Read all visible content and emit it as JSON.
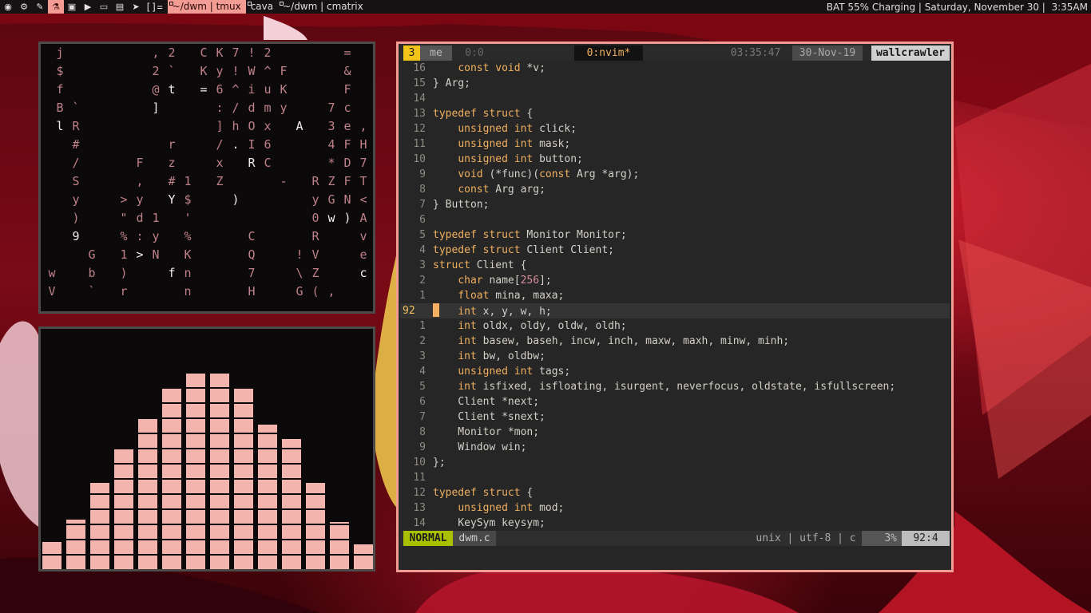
{
  "colors": {
    "accent": "#f29c94",
    "bar_bg": "#141213",
    "mode_green": "#a8c000",
    "keyword": "#f0b060",
    "number": "#d88ea0"
  },
  "topbar": {
    "icons": [
      "firefox-icon",
      "steam-icon",
      "brush-icon",
      "flask-icon",
      "image-icon",
      "video-icon",
      "monitor-icon",
      "folder-icon",
      "telegram-icon"
    ],
    "layout": "[]=",
    "tags": [
      {
        "label": "~/dwm | tmux",
        "active": true
      },
      {
        "label": "cava",
        "active": false
      },
      {
        "label": "~/dwm | cmatrix",
        "active": false
      }
    ],
    "status": "BAT 55% Charging | Saturday, November 30 |  3:35AM"
  },
  "cmatrix": {
    "cells": [
      [
        "j",
        0,
        0
      ],
      [
        "$",
        0,
        1
      ],
      [
        "f",
        0,
        2
      ],
      [
        "B",
        0,
        3
      ],
      [
        "l",
        0,
        4
      ],
      [
        "`",
        1,
        3
      ],
      [
        "R",
        1,
        4
      ],
      [
        "#",
        1,
        5
      ],
      [
        "/",
        1,
        6
      ],
      [
        "S",
        1,
        7
      ],
      [
        "y",
        1,
        8
      ],
      [
        ")",
        1,
        9
      ],
      [
        "9",
        1,
        10
      ],
      [
        "G",
        2,
        11
      ],
      [
        "b",
        2,
        12
      ],
      [
        "`",
        2,
        13
      ],
      [
        "w",
        -1,
        12
      ],
      [
        "V",
        -1,
        13
      ],
      [
        ">",
        4,
        8
      ],
      [
        "\"",
        4,
        9
      ],
      [
        "%",
        4,
        10
      ],
      [
        "1",
        4,
        11
      ],
      [
        ")",
        4,
        12
      ],
      [
        "r",
        4,
        13
      ],
      [
        "F",
        5,
        6
      ],
      [
        ",",
        5,
        7
      ],
      [
        "y",
        5,
        8
      ],
      [
        "d",
        5,
        9
      ],
      [
        ":",
        5,
        10
      ],
      [
        ">",
        5,
        11
      ],
      [
        ",",
        6,
        0
      ],
      [
        "2",
        6,
        1
      ],
      [
        "@",
        6,
        2
      ],
      [
        "]",
        6,
        3
      ],
      [
        "r",
        7,
        5
      ],
      [
        "z",
        7,
        6
      ],
      [
        "#",
        7,
        7
      ],
      [
        "Y",
        7,
        8
      ],
      [
        "1",
        6,
        9
      ],
      [
        "y",
        6,
        10
      ],
      [
        "N",
        6,
        11
      ],
      [
        "f",
        7,
        12
      ],
      [
        "2",
        7,
        0
      ],
      [
        "`",
        7,
        1
      ],
      [
        "t",
        7,
        2
      ],
      [
        "1",
        8,
        7
      ],
      [
        "$",
        8,
        8
      ],
      [
        "'",
        8,
        9
      ],
      [
        "%",
        8,
        10
      ],
      [
        "K",
        8,
        11
      ],
      [
        "n",
        8,
        12
      ],
      [
        "n",
        8,
        13
      ],
      [
        "C",
        9,
        0
      ],
      [
        "K",
        9,
        1
      ],
      [
        "=",
        9,
        2
      ],
      [
        "K",
        10,
        0
      ],
      [
        "y",
        10,
        1
      ],
      [
        "6",
        10,
        2
      ],
      [
        ":",
        10,
        3
      ],
      [
        "]",
        10,
        4
      ],
      [
        "/",
        10,
        5
      ],
      [
        "x",
        10,
        6
      ],
      [
        "Z",
        10,
        7
      ],
      [
        ")",
        11,
        8
      ],
      [
        "7",
        11,
        0
      ],
      [
        "!",
        11,
        1
      ],
      [
        "^",
        11,
        2
      ],
      [
        "/",
        11,
        3
      ],
      [
        "h",
        11,
        4
      ],
      [
        ".",
        11,
        5
      ],
      [
        "R",
        12,
        6
      ],
      [
        "!",
        12,
        0
      ],
      [
        "W",
        12,
        1
      ],
      [
        "i",
        12,
        2
      ],
      [
        "d",
        12,
        3
      ],
      [
        "O",
        12,
        4
      ],
      [
        "I",
        12,
        5
      ],
      [
        "C",
        12,
        10
      ],
      [
        "Q",
        12,
        11
      ],
      [
        "7",
        12,
        12
      ],
      [
        "H",
        12,
        13
      ],
      [
        "2",
        13,
        0
      ],
      [
        "^",
        13,
        1
      ],
      [
        "u",
        13,
        2
      ],
      [
        "m",
        13,
        3
      ],
      [
        "x",
        13,
        4
      ],
      [
        "6",
        13,
        5
      ],
      [
        "C",
        13,
        6
      ],
      [
        "-",
        14,
        7
      ],
      [
        "F",
        14,
        1
      ],
      [
        "K",
        14,
        2
      ],
      [
        "y",
        14,
        3
      ],
      [
        "A",
        15,
        4
      ],
      [
        "R",
        16,
        7
      ],
      [
        "y",
        16,
        8
      ],
      [
        "0",
        16,
        9
      ],
      [
        "R",
        16,
        10
      ],
      [
        "V",
        16,
        11
      ],
      [
        "Z",
        16,
        12
      ],
      [
        "G",
        15,
        13
      ],
      [
        "!",
        15,
        11
      ],
      [
        "\\",
        15,
        12
      ],
      [
        "(",
        16,
        13
      ],
      [
        "7",
        17,
        3
      ],
      [
        "3",
        17,
        4
      ],
      [
        "4",
        17,
        5
      ],
      [
        "*",
        17,
        6
      ],
      [
        "Z",
        17,
        7
      ],
      [
        "G",
        17,
        8
      ],
      [
        "w",
        17,
        9
      ],
      [
        ",",
        17,
        13
      ],
      [
        "=",
        18,
        0
      ],
      [
        "&",
        18,
        1
      ],
      [
        "F",
        18,
        2
      ],
      [
        "c",
        18,
        3
      ],
      [
        "e",
        18,
        4
      ],
      [
        "F",
        18,
        5
      ],
      [
        "D",
        18,
        6
      ],
      [
        "F",
        18,
        7
      ],
      [
        "N",
        18,
        8
      ],
      [
        ")",
        18,
        9
      ],
      [
        ",",
        19,
        4
      ],
      [
        "H",
        19,
        5
      ],
      [
        "7",
        19,
        6
      ],
      [
        "T",
        19,
        7
      ],
      [
        "<",
        19,
        8
      ],
      [
        "A",
        19,
        9
      ],
      [
        "v",
        19,
        10
      ],
      [
        "e",
        19,
        11
      ],
      [
        "c",
        19,
        12
      ],
      [
        "l",
        20,
        9
      ],
      [
        "'",
        20,
        10
      ],
      [
        ";",
        20,
        11
      ],
      [
        "9",
        20,
        12
      ],
      [
        "s",
        20,
        13
      ]
    ],
    "bright": [
      "l:0,4",
      "t:7,2",
      "=:9,2",
      "]:6,3",
      "A:15,4",
      ".:11,5",
      "R:12,6",
      "Y:7,8",
      "):11,8",
      "9:1,10",
      ">:5,11",
      "f:7,12",
      "w:17,9",
      "):18,9",
      "c:19,12"
    ]
  },
  "cava": {
    "levels": [
      0.13,
      0.24,
      0.42,
      0.58,
      0.73,
      0.88,
      0.95,
      0.95,
      0.88,
      0.7,
      0.63,
      0.42,
      0.23,
      0.12
    ]
  },
  "tmux": {
    "window_index": "3",
    "session": "me",
    "inactive_window": "0:0",
    "active_window": "0:nvim*",
    "time": "03:35:47",
    "date": "30-Nov-19",
    "host": "wallcrawler"
  },
  "nvim": {
    "lines": [
      {
        "n": "16",
        "t": [
          [
            "    ",
            ""
          ],
          [
            "const",
            "kw"
          ],
          [
            " ",
            ""
          ],
          [
            "void",
            "kw"
          ],
          [
            " *v;",
            ""
          ]
        ]
      },
      {
        "n": "15",
        "t": [
          [
            "} Arg;",
            ""
          ]
        ]
      },
      {
        "n": "14",
        "t": []
      },
      {
        "n": "13",
        "t": [
          [
            "typedef",
            "kw"
          ],
          [
            " ",
            ""
          ],
          [
            "struct",
            "kw"
          ],
          [
            " {",
            ""
          ]
        ]
      },
      {
        "n": "12",
        "t": [
          [
            "    ",
            ""
          ],
          [
            "unsigned",
            "kw"
          ],
          [
            " ",
            ""
          ],
          [
            "int",
            "kw"
          ],
          [
            " click;",
            ""
          ]
        ]
      },
      {
        "n": "11",
        "t": [
          [
            "    ",
            ""
          ],
          [
            "unsigned",
            "kw"
          ],
          [
            " ",
            ""
          ],
          [
            "int",
            "kw"
          ],
          [
            " mask;",
            ""
          ]
        ]
      },
      {
        "n": "10",
        "t": [
          [
            "    ",
            ""
          ],
          [
            "unsigned",
            "kw"
          ],
          [
            " ",
            ""
          ],
          [
            "int",
            "kw"
          ],
          [
            " button;",
            ""
          ]
        ]
      },
      {
        "n": "9",
        "t": [
          [
            "    ",
            ""
          ],
          [
            "void",
            "kw"
          ],
          [
            " (*func)(",
            ""
          ],
          [
            "const",
            "kw"
          ],
          [
            " Arg *arg);",
            ""
          ]
        ]
      },
      {
        "n": "8",
        "t": [
          [
            "    ",
            ""
          ],
          [
            "const",
            "kw"
          ],
          [
            " Arg arg;",
            ""
          ]
        ]
      },
      {
        "n": "7",
        "t": [
          [
            "} Button;",
            ""
          ]
        ]
      },
      {
        "n": "6",
        "t": []
      },
      {
        "n": "5",
        "t": [
          [
            "typedef",
            "kw"
          ],
          [
            " ",
            ""
          ],
          [
            "struct",
            "kw"
          ],
          [
            " Monitor Monitor;",
            ""
          ]
        ]
      },
      {
        "n": "4",
        "t": [
          [
            "typedef",
            "kw"
          ],
          [
            " ",
            ""
          ],
          [
            "struct",
            "kw"
          ],
          [
            " Client Client;",
            ""
          ]
        ]
      },
      {
        "n": "3",
        "t": [
          [
            "struct",
            "kw"
          ],
          [
            " Client {",
            ""
          ]
        ]
      },
      {
        "n": "2",
        "t": [
          [
            "    ",
            ""
          ],
          [
            "char",
            "kw"
          ],
          [
            " name[",
            ""
          ],
          [
            "256",
            "num"
          ],
          [
            "];",
            ""
          ]
        ]
      },
      {
        "n": "1",
        "t": [
          [
            "    ",
            ""
          ],
          [
            "float",
            "kw"
          ],
          [
            " mina, maxa;",
            ""
          ]
        ]
      },
      {
        "n": "92",
        "cur": true,
        "t": [
          [
            "    ",
            "cursor"
          ],
          [
            "int",
            "kw"
          ],
          [
            " x, y, w, h;",
            ""
          ]
        ]
      },
      {
        "n": "1",
        "t": [
          [
            "    ",
            ""
          ],
          [
            "int",
            "kw"
          ],
          [
            " oldx, oldy, oldw, oldh;",
            ""
          ]
        ]
      },
      {
        "n": "2",
        "t": [
          [
            "    ",
            ""
          ],
          [
            "int",
            "kw"
          ],
          [
            " basew, baseh, incw, inch, maxw, maxh, minw, minh;",
            ""
          ]
        ]
      },
      {
        "n": "3",
        "t": [
          [
            "    ",
            ""
          ],
          [
            "int",
            "kw"
          ],
          [
            " bw, oldbw;",
            ""
          ]
        ]
      },
      {
        "n": "4",
        "t": [
          [
            "    ",
            ""
          ],
          [
            "unsigned",
            "kw"
          ],
          [
            " ",
            ""
          ],
          [
            "int",
            "kw"
          ],
          [
            " tags;",
            ""
          ]
        ]
      },
      {
        "n": "5",
        "t": [
          [
            "    ",
            ""
          ],
          [
            "int",
            "kw"
          ],
          [
            " isfixed, isfloating, isurgent, neverfocus, oldstate, isfullscreen;",
            ""
          ]
        ]
      },
      {
        "n": "6",
        "t": [
          [
            "    Client *next;",
            ""
          ]
        ]
      },
      {
        "n": "7",
        "t": [
          [
            "    Client *snext;",
            ""
          ]
        ]
      },
      {
        "n": "8",
        "t": [
          [
            "    Monitor *mon;",
            ""
          ]
        ]
      },
      {
        "n": "9",
        "t": [
          [
            "    Window win;",
            ""
          ]
        ]
      },
      {
        "n": "10",
        "t": [
          [
            "};",
            ""
          ]
        ]
      },
      {
        "n": "11",
        "t": []
      },
      {
        "n": "12",
        "t": [
          [
            "typedef",
            "kw"
          ],
          [
            " ",
            ""
          ],
          [
            "struct",
            "kw"
          ],
          [
            " {",
            ""
          ]
        ]
      },
      {
        "n": "13",
        "t": [
          [
            "    ",
            ""
          ],
          [
            "unsigned",
            "kw"
          ],
          [
            " ",
            ""
          ],
          [
            "int",
            "kw"
          ],
          [
            " mod;",
            ""
          ]
        ]
      },
      {
        "n": "14",
        "t": [
          [
            "    KeySym keysym;",
            ""
          ]
        ]
      }
    ],
    "status": {
      "mode": "NORMAL",
      "file": "dwm.c",
      "fileinfo": "unix | utf-8 | c",
      "percent": "3%",
      "position": "92:4"
    }
  }
}
